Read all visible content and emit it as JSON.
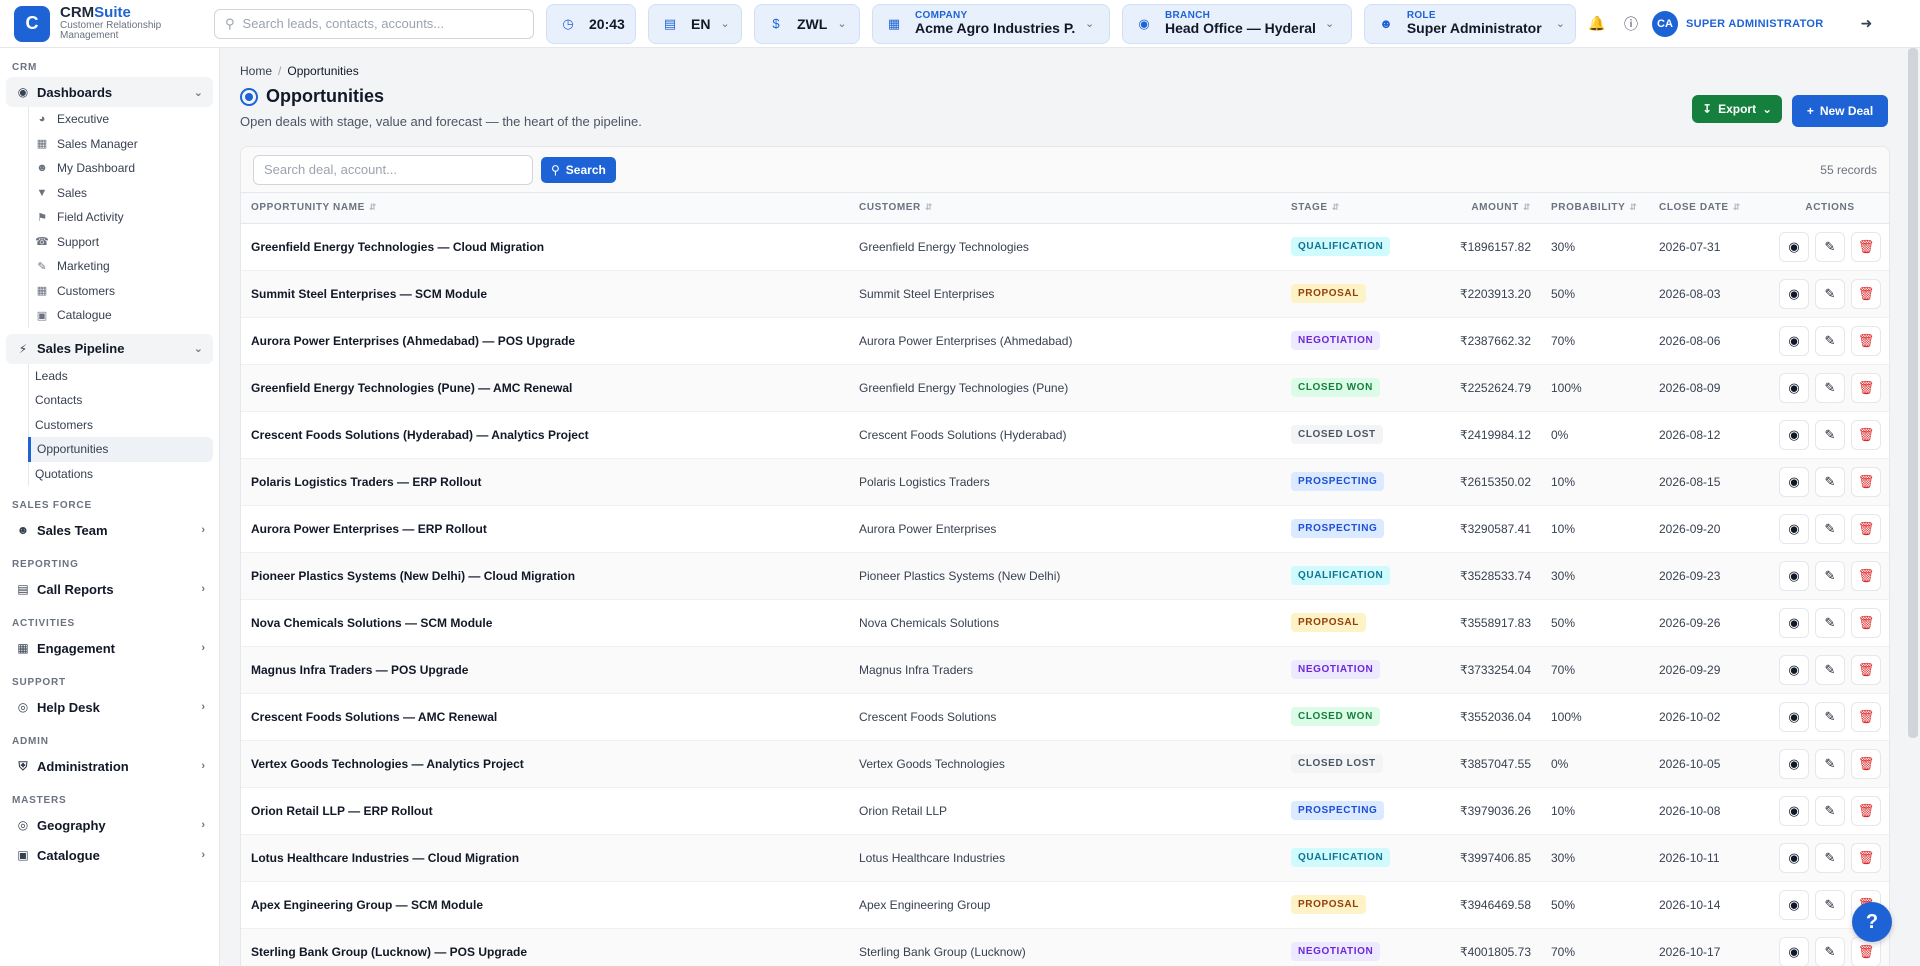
{
  "brand": {
    "name_prefix": "CRM",
    "name_accent": "Suite",
    "subtitle": "Customer Relationship Management",
    "logo_letter": "C"
  },
  "topbar": {
    "search_placeholder": "Search leads, contacts, accounts...",
    "time": "20:43",
    "language": "EN",
    "currency": "ZWL",
    "company_label": "COMPANY",
    "company_value": "Acme Agro Industries P...",
    "branch_label": "BRANCH",
    "branch_value": "Head Office — Hyderab...",
    "role_label": "ROLE",
    "role_value": "Super Administrator",
    "avatar_initials": "CA",
    "user_role": "SUPER ADMINISTRATOR"
  },
  "sidebar": {
    "crm_title": "CRM",
    "dashboards_label": "Dashboards",
    "dashboards": [
      "Executive",
      "Sales Manager",
      "My Dashboard",
      "Sales",
      "Field Activity",
      "Support",
      "Marketing",
      "Customers",
      "Catalogue"
    ],
    "pipeline_label": "Sales Pipeline",
    "pipeline": [
      "Leads",
      "Contacts",
      "Customers",
      "Opportunities",
      "Quotations"
    ],
    "salesforce_title": "SALES FORCE",
    "salesforce_item": "Sales Team",
    "reporting_title": "REPORTING",
    "reporting_item": "Call Reports",
    "activities_title": "ACTIVITIES",
    "activities_item": "Engagement",
    "support_title": "SUPPORT",
    "support_item": "Help Desk",
    "admin_title": "ADMIN",
    "admin_item": "Administration",
    "masters_title": "MASTERS",
    "masters_items": [
      "Geography",
      "Catalogue"
    ]
  },
  "page": {
    "breadcrumb_home": "Home",
    "breadcrumb_current": "Opportunities",
    "title": "Opportunities",
    "subtitle": "Open deals with stage, value and forecast — the heart of the pipeline.",
    "export_label": "Export",
    "new_label": "New Deal"
  },
  "table": {
    "search_placeholder": "Search deal, account...",
    "search_button": "Search",
    "record_count": "55 records",
    "columns": [
      "OPPORTUNITY NAME",
      "CUSTOMER",
      "STAGE",
      "AMOUNT",
      "PROBABILITY",
      "CLOSE DATE",
      "ACTIONS"
    ],
    "rows": [
      {
        "name": "Greenfield Energy Technologies — Cloud Migration",
        "customer": "Greenfield Energy Technologies",
        "stage": "QUALIFICATION",
        "amount": "₹1896157.82",
        "prob": "30%",
        "date": "2026-07-31"
      },
      {
        "name": "Summit Steel Enterprises — SCM Module",
        "customer": "Summit Steel Enterprises",
        "stage": "PROPOSAL",
        "amount": "₹2203913.20",
        "prob": "50%",
        "date": "2026-08-03"
      },
      {
        "name": "Aurora Power Enterprises (Ahmedabad) — POS Upgrade",
        "customer": "Aurora Power Enterprises (Ahmedabad)",
        "stage": "NEGOTIATION",
        "amount": "₹2387662.32",
        "prob": "70%",
        "date": "2026-08-06"
      },
      {
        "name": "Greenfield Energy Technologies (Pune) — AMC Renewal",
        "customer": "Greenfield Energy Technologies (Pune)",
        "stage": "CLOSED WON",
        "amount": "₹2252624.79",
        "prob": "100%",
        "date": "2026-08-09"
      },
      {
        "name": "Crescent Foods Solutions (Hyderabad) — Analytics Project",
        "customer": "Crescent Foods Solutions (Hyderabad)",
        "stage": "CLOSED LOST",
        "amount": "₹2419984.12",
        "prob": "0%",
        "date": "2026-08-12"
      },
      {
        "name": "Polaris Logistics Traders — ERP Rollout",
        "customer": "Polaris Logistics Traders",
        "stage": "PROSPECTING",
        "amount": "₹2615350.02",
        "prob": "10%",
        "date": "2026-08-15"
      },
      {
        "name": "Aurora Power Enterprises — ERP Rollout",
        "customer": "Aurora Power Enterprises",
        "stage": "PROSPECTING",
        "amount": "₹3290587.41",
        "prob": "10%",
        "date": "2026-09-20"
      },
      {
        "name": "Pioneer Plastics Systems (New Delhi) — Cloud Migration",
        "customer": "Pioneer Plastics Systems (New Delhi)",
        "stage": "QUALIFICATION",
        "amount": "₹3528533.74",
        "prob": "30%",
        "date": "2026-09-23"
      },
      {
        "name": "Nova Chemicals Solutions — SCM Module",
        "customer": "Nova Chemicals Solutions",
        "stage": "PROPOSAL",
        "amount": "₹3558917.83",
        "prob": "50%",
        "date": "2026-09-26"
      },
      {
        "name": "Magnus Infra Traders — POS Upgrade",
        "customer": "Magnus Infra Traders",
        "stage": "NEGOTIATION",
        "amount": "₹3733254.04",
        "prob": "70%",
        "date": "2026-09-29"
      },
      {
        "name": "Crescent Foods Solutions — AMC Renewal",
        "customer": "Crescent Foods Solutions",
        "stage": "CLOSED WON",
        "amount": "₹3552036.04",
        "prob": "100%",
        "date": "2026-10-02"
      },
      {
        "name": "Vertex Goods Technologies — Analytics Project",
        "customer": "Vertex Goods Technologies",
        "stage": "CLOSED LOST",
        "amount": "₹3857047.55",
        "prob": "0%",
        "date": "2026-10-05"
      },
      {
        "name": "Orion Retail LLP — ERP Rollout",
        "customer": "Orion Retail LLP",
        "stage": "PROSPECTING",
        "amount": "₹3979036.26",
        "prob": "10%",
        "date": "2026-10-08"
      },
      {
        "name": "Lotus Healthcare Industries — Cloud Migration",
        "customer": "Lotus Healthcare Industries",
        "stage": "QUALIFICATION",
        "amount": "₹3997406.85",
        "prob": "30%",
        "date": "2026-10-11"
      },
      {
        "name": "Apex Engineering Group — SCM Module",
        "customer": "Apex Engineering Group",
        "stage": "PROPOSAL",
        "amount": "₹3946469.58",
        "prob": "50%",
        "date": "2026-10-14"
      },
      {
        "name": "Sterling Bank Group (Lucknow) — POS Upgrade",
        "customer": "Sterling Bank Group (Lucknow)",
        "stage": "NEGOTIATION",
        "amount": "₹4001805.73",
        "prob": "70%",
        "date": "2026-10-17"
      }
    ]
  },
  "stage_colors": {
    "QUALIFICATION": {
      "bg": "#cffafe",
      "fg": "#0e7490"
    },
    "PROPOSAL": {
      "bg": "#fef3c7",
      "fg": "#92400e"
    },
    "NEGOTIATION": {
      "bg": "#ede9fe",
      "fg": "#6d28d9"
    },
    "CLOSED WON": {
      "bg": "#dcfce7",
      "fg": "#15803d"
    },
    "CLOSED LOST": {
      "bg": "#f3f4f6",
      "fg": "#4b5563"
    },
    "PROSPECTING": {
      "bg": "#dbeafe",
      "fg": "#1d4ed8"
    }
  },
  "colors": {
    "primary": "#1e63d6",
    "success": "#15803d",
    "danger": "#dc2626"
  },
  "help_glyph": "?"
}
